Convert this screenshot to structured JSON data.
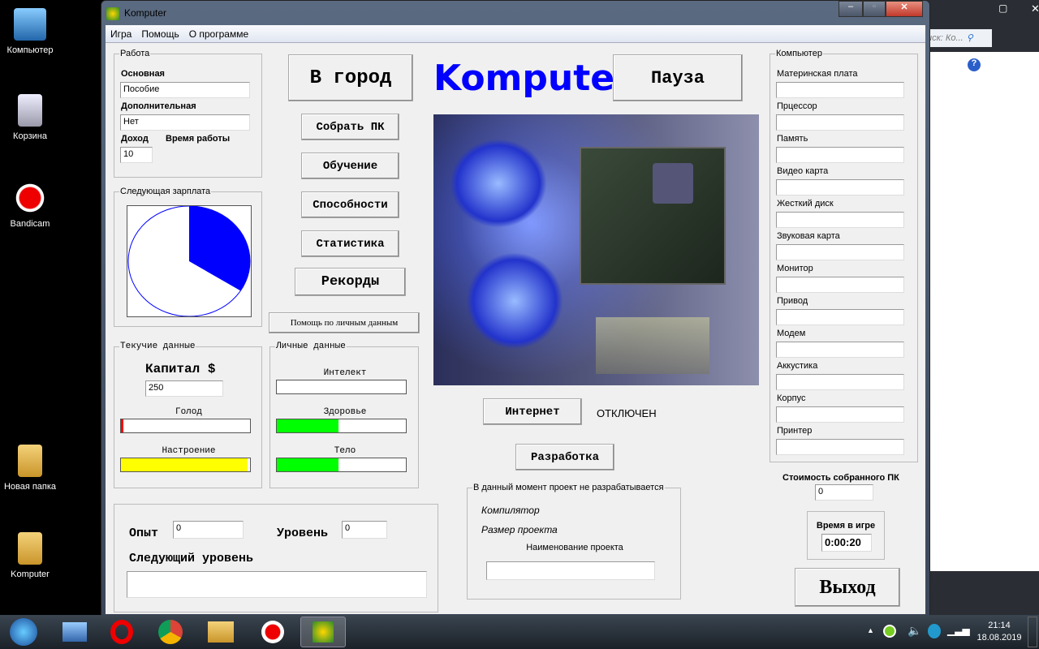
{
  "desktop": {
    "icons": [
      {
        "label": "Компьютер"
      },
      {
        "label": "Корзина"
      },
      {
        "label": "Bandicam"
      },
      {
        "label": "Новая папка"
      },
      {
        "label": "Komputer"
      }
    ]
  },
  "bg_window": {
    "search_placeholder": "иск: Ко..."
  },
  "window": {
    "title": "Komputer"
  },
  "menu": [
    "Игра",
    "Помощь",
    "О программе"
  ],
  "work": {
    "legend": "Работа",
    "main_label": "Основная",
    "main_value": "Пособие",
    "extra_label": "Дополнительная",
    "extra_value": "Нет",
    "income_label": "Доход",
    "income_value": "10",
    "time_label": "Время работы"
  },
  "salary": {
    "legend": "Следующая зарплата",
    "progress": 0.34,
    "color": "#0000ff"
  },
  "buttons": {
    "to_city": "В город",
    "build_pc": "Собрать ПК",
    "learning": "Обучение",
    "abilities": "Способности",
    "stats": "Статистика",
    "records": "Рекорды",
    "help_personal": "Помощь по личным данным",
    "pause": "Пауза",
    "internet": "Интернет",
    "development": "Разработка",
    "exit": "Выход"
  },
  "logo": "Komputer",
  "internet_status": "ОТКЛЮЧЕН",
  "current": {
    "legend": "Текучие данные",
    "capital_label": "Капитал $",
    "capital_value": "250",
    "hunger_label": "Голод",
    "hunger": 0.02,
    "mood_label": "Настроение",
    "mood": 0.98
  },
  "personal": {
    "legend": "Личные данные",
    "intellect_label": "Интелект",
    "intellect": 0,
    "health_label": "Здоровье",
    "health": 0.48,
    "body_label": "Тело",
    "body": 0.48
  },
  "colors": {
    "hunger": "#ff0000",
    "mood": "#ffff00",
    "health": "#00ff00",
    "body": "#00ff00"
  },
  "exp": {
    "exp_label": "Опыт",
    "exp_value": "0",
    "level_label": "Уровень",
    "level_value": "0",
    "next_label": "Следующий уровень"
  },
  "project": {
    "legend": "В данный момент проект не разрабатывается",
    "compiler": "Компилятор",
    "size": "Размер проекта",
    "name_label": "Наименование проекта"
  },
  "computer": {
    "legend": "Компьютер",
    "parts": [
      "Материнская плата",
      "Прцессор",
      "Память",
      "Видео карта",
      "Жесткий диск",
      "Звуковая карта",
      "Монитор",
      "Привод",
      "Модем",
      "Аккустика",
      "Корпус",
      "Принтер"
    ]
  },
  "cost": {
    "label": "Стоимость собранного ПК",
    "value": "0"
  },
  "gametime": {
    "label": "Время в игре",
    "value": "0:00:20"
  },
  "tray": {
    "time": "21:14",
    "date": "18.08.2019"
  }
}
